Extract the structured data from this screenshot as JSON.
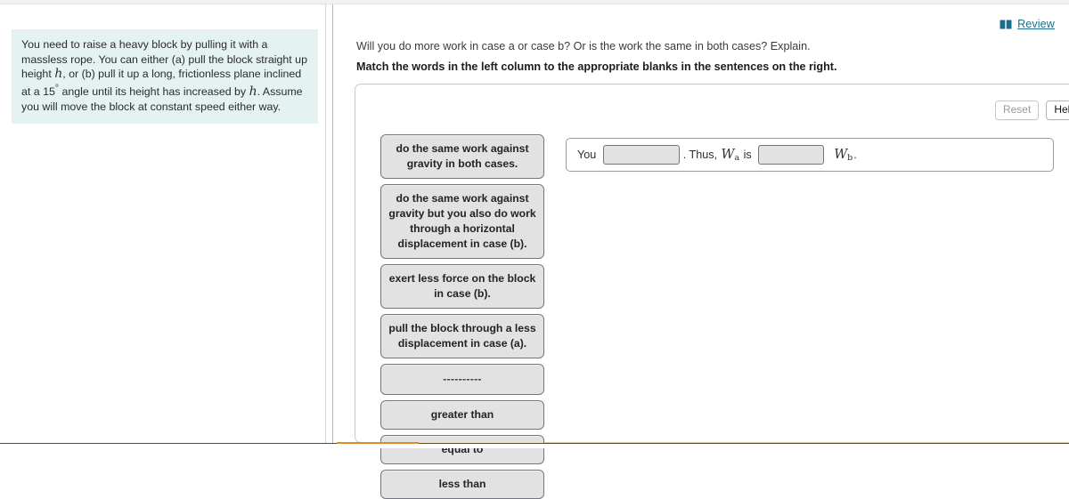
{
  "problem": {
    "text_part1": "You need to raise a heavy block by pulling it with a massless rope. You can either (a) pull the block straight up height ",
    "var_h1": "h",
    "text_part2": ", or (b) pull it up a long, frictionless plane inclined at a 15",
    "degree": "°",
    "text_part3": " angle until its height has increased by ",
    "var_h2": "h",
    "text_part4": ". Assume you will move the block at constant speed either way."
  },
  "header": {
    "review_label": "Review",
    "review_icon": "book-icon"
  },
  "question": {
    "prompt": "Will you do more work in case a or case b? Or is the work the same in both cases? Explain.",
    "instruction": "Match the words in the left column to the appropriate blanks in the sentences on the right."
  },
  "toolbar": {
    "reset_label": "Reset",
    "help_label": "Help"
  },
  "word_bank": {
    "tiles": [
      {
        "label": "do the same work against gravity in both cases."
      },
      {
        "label": "do the same work against gravity but you also do work through a horizontal displacement in case (b)."
      },
      {
        "label": "exert less force on the block in case (b)."
      },
      {
        "label": "pull the block through a less displacement in case (a)."
      },
      {
        "label": "----------"
      },
      {
        "label": "greater than"
      },
      {
        "label": "equal to"
      },
      {
        "label": "less than"
      }
    ]
  },
  "sentence": {
    "lead": "You",
    "blank1_value": "",
    "mid": ". Thus,",
    "var_a": "W",
    "var_a_sub": "a",
    "is_word": "is",
    "blank2_value": "",
    "var_b": "W",
    "var_b_sub": "b",
    "period": "."
  },
  "colors": {
    "problem_bg": "#e4f3f1",
    "link": "#1c6e8c",
    "tile_bg": "#e2e2e2",
    "tile_border": "#75757f",
    "progress_orange": "#e2892b"
  }
}
